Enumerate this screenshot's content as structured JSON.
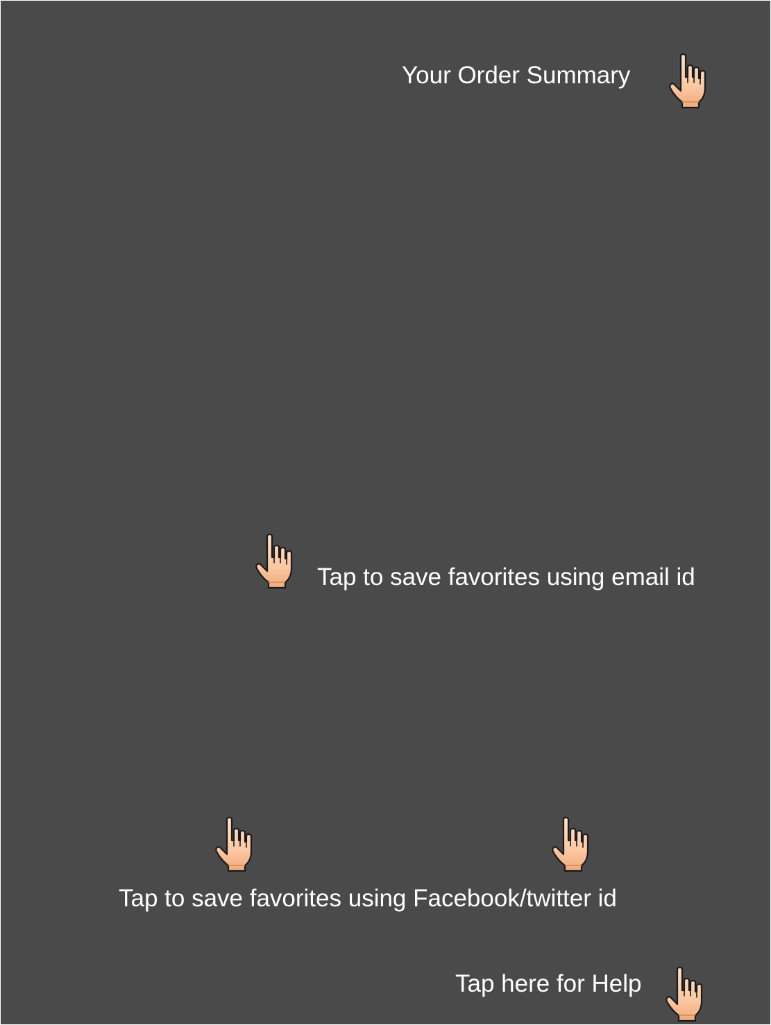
{
  "overlay": {
    "background_color": "#4a4a4a",
    "text_color": "#ffffff",
    "hand_fill": "#fbc9a4",
    "hand_outline": "#1a1a1a"
  },
  "hints": {
    "order_summary": {
      "label": "Your Order Summary",
      "icon": "pointing-hand-icon"
    },
    "save_email": {
      "label": "Tap to save favorites using email id",
      "icon": "pointing-hand-icon"
    },
    "save_social": {
      "label": "Tap to save favorites using Facebook/twitter id",
      "icon": "pointing-hand-icon"
    },
    "help": {
      "label": "Tap here for Help",
      "icon": "pointing-hand-icon"
    }
  }
}
